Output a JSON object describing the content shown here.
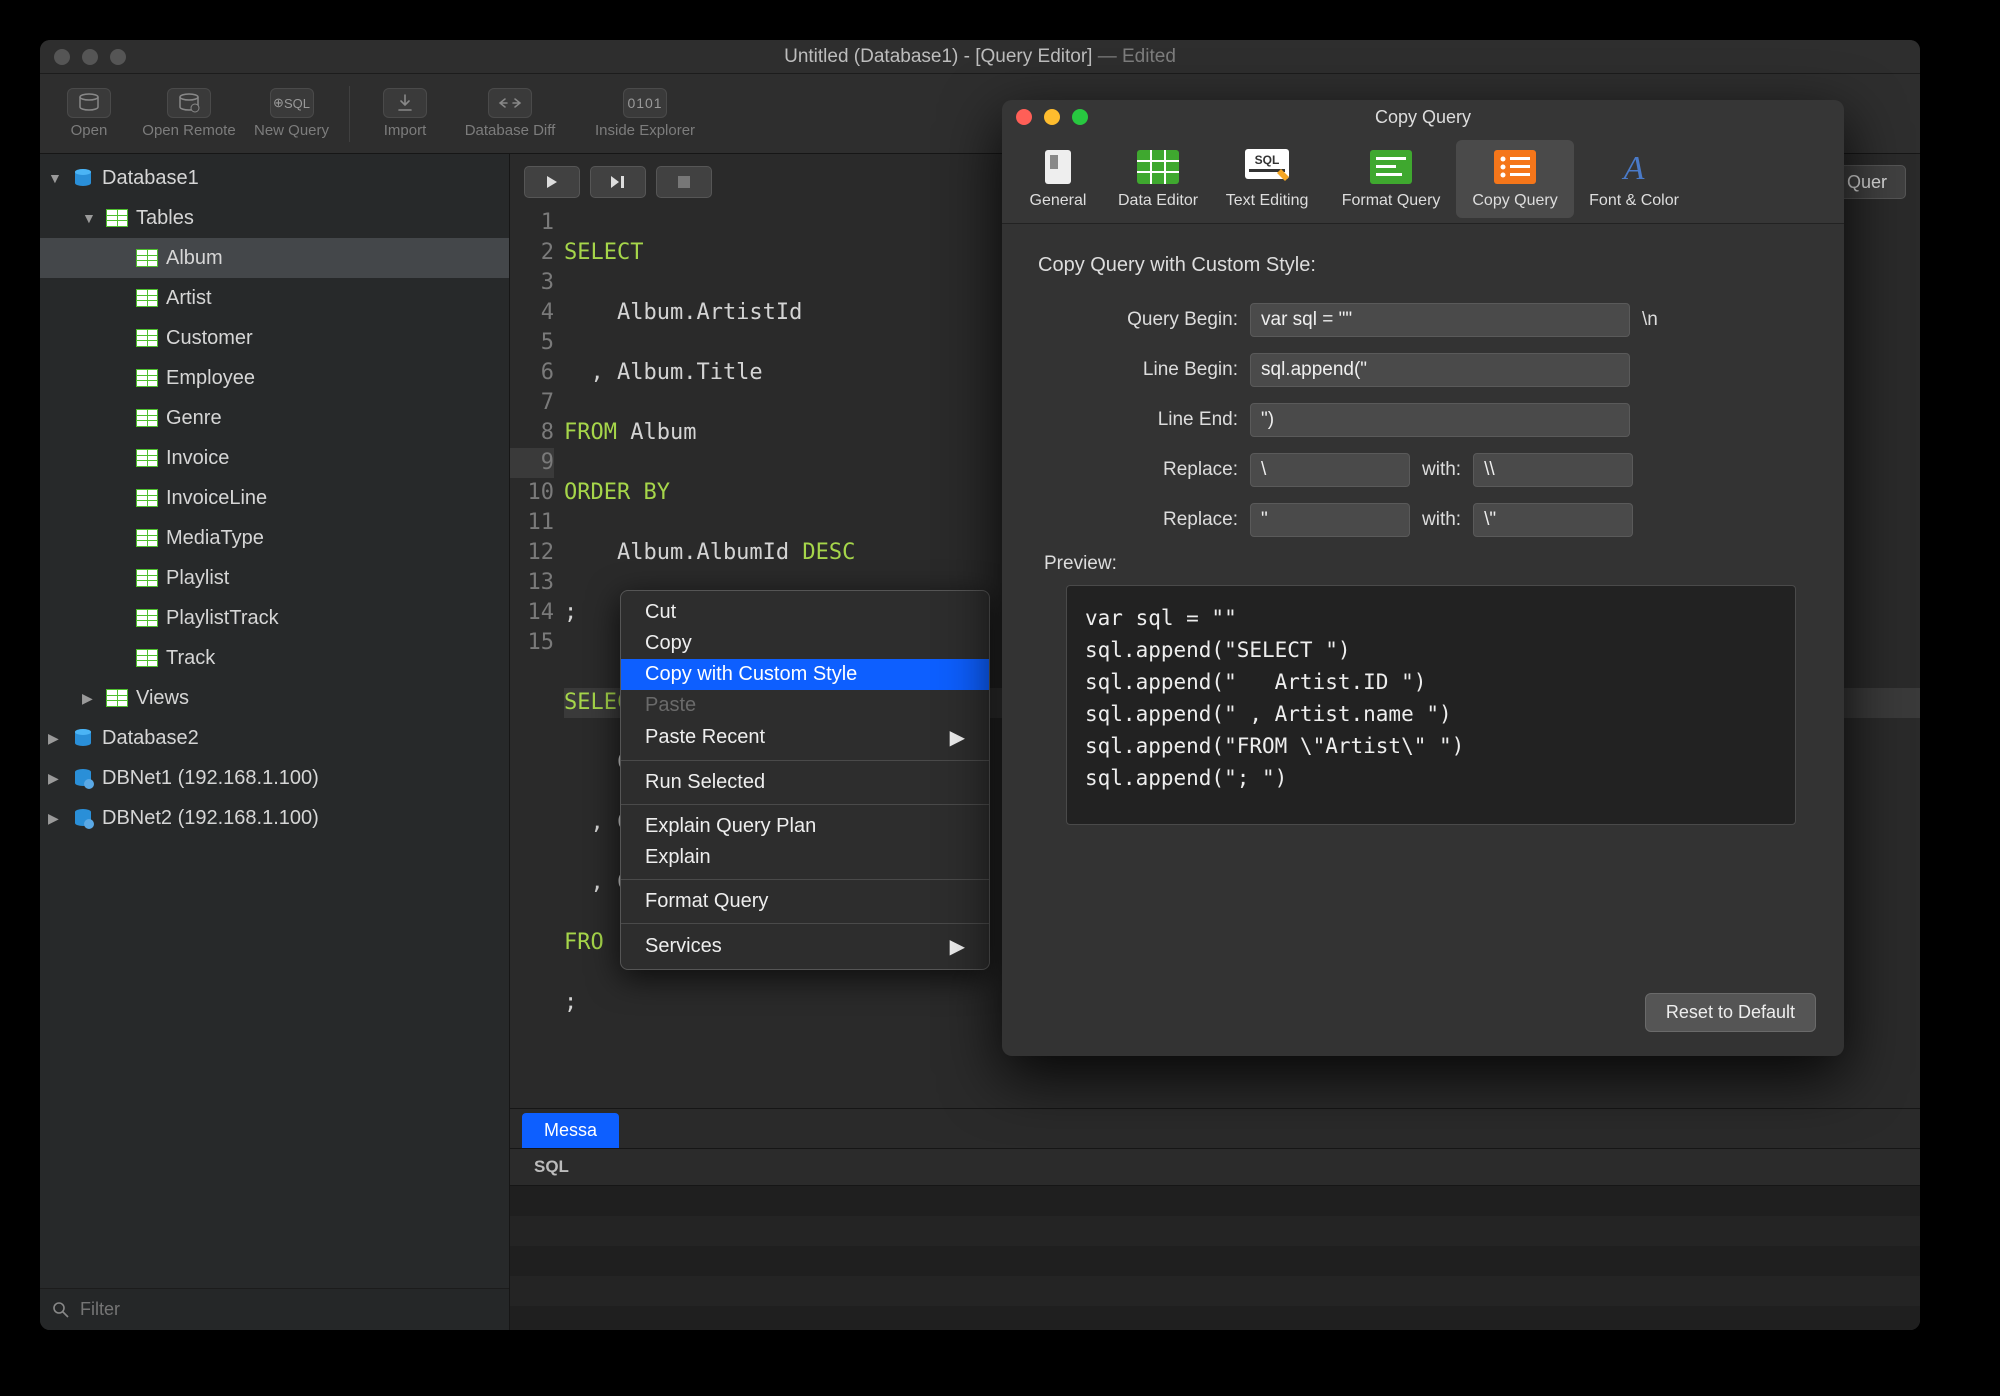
{
  "window": {
    "title_main": "Untitled (Database1) - [Query Editor]",
    "title_suffix": " — Edited"
  },
  "toolbar": {
    "open": "Open",
    "open_remote": "Open Remote",
    "new_query": "New Query",
    "import": "Import",
    "db_diff": "Database Diff",
    "inside_explorer": "Inside Explorer",
    "sql_badge": "SQL",
    "binary": "0101"
  },
  "sidebar": {
    "db1": "Database1",
    "tables": "Tables",
    "table_list": [
      "Album",
      "Artist",
      "Customer",
      "Employee",
      "Genre",
      "Invoice",
      "InvoiceLine",
      "MediaType",
      "Playlist",
      "PlaylistTrack",
      "Track"
    ],
    "views": "Views",
    "db2": "Database2",
    "dbnet1": "DBNet1 (192.168.1.100)",
    "dbnet2": "DBNet2 (192.168.1.100)",
    "filter_placeholder": "Filter"
  },
  "editor": {
    "explain_btn": "Explain Quer",
    "lines": [
      "1",
      "2",
      "3",
      "4",
      "5",
      "6",
      "7",
      "8",
      "9",
      "10",
      "11",
      "12",
      "13",
      "14",
      "15"
    ],
    "code": {
      "l1_kw": "SELECT",
      "l2": "    Album.ArtistId",
      "l3": "  , Album.Title",
      "l4_kw": "FROM",
      "l4_rest": " Album",
      "l5_kw": "ORDER BY",
      "l6a": "    Album.AlbumId ",
      "l6_kw": "DESC",
      "l7": ";",
      "l8": "",
      "l9_kw": "SELECT",
      "l10": "    Customer.CustomerId",
      "l11": "  , Customer.FirstName",
      "l12": "  , Customer.City",
      "l13_kw": "FRO",
      "l14": ";",
      "l15": ""
    },
    "tab_messages": "Messa",
    "col_sql": "SQL"
  },
  "context_menu": {
    "cut": "Cut",
    "copy": "Copy",
    "copy_custom": "Copy with Custom Style",
    "paste": "Paste",
    "paste_recent": "Paste Recent",
    "run_selected": "Run Selected",
    "explain_plan": "Explain Query Plan",
    "explain": "Explain",
    "format": "Format Query",
    "services": "Services"
  },
  "prefs": {
    "title": "Copy Query",
    "tabs": {
      "general": "General",
      "data_editor": "Data Editor",
      "text_editing": "Text Editing",
      "format_query": "Format Query",
      "copy_query": "Copy Query",
      "font_color": "Font & Color"
    },
    "heading": "Copy Query with Custom Style:",
    "labels": {
      "query_begin": "Query Begin:",
      "line_begin": "Line Begin:",
      "line_end": "Line End:",
      "replace": "Replace:",
      "with": "with:",
      "preview": "Preview:"
    },
    "values": {
      "query_begin": "var sql = \"\"",
      "query_begin_suffix": "\\n",
      "line_begin": "sql.append(\"",
      "line_end": "\")",
      "replace1_from": "\\",
      "replace1_to": "\\\\",
      "replace2_from": "\"",
      "replace2_to": "\\\""
    },
    "preview": "var sql = \"\"\nsql.append(\"SELECT \")\nsql.append(\"   Artist.ID \")\nsql.append(\" , Artist.name \")\nsql.append(\"FROM \\\"Artist\\\" \")\nsql.append(\"; \")",
    "reset": "Reset to Default"
  }
}
